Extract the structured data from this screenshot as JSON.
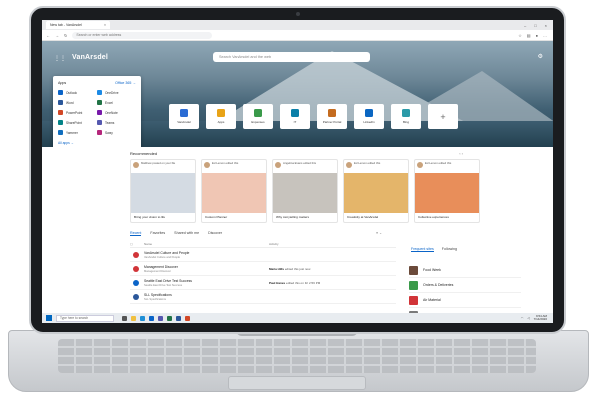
{
  "browser": {
    "tab_title": "New tab - VanArsdel",
    "address_placeholder": "Search or enter web address"
  },
  "header": {
    "brand": "VanArsdel",
    "search_placeholder": "Search VanArsdel and the web"
  },
  "quick_links": [
    {
      "label": "VanArsdel",
      "color": "#2b6cd4"
    },
    {
      "label": "Apps",
      "color": "#e8a317"
    },
    {
      "label": "Expenses",
      "color": "#3a9a4a"
    },
    {
      "label": "IT",
      "color": "#0a7fa8"
    },
    {
      "label": "Partner Portal",
      "color": "#c46b1f"
    },
    {
      "label": "LinkedIn",
      "color": "#0a66c2"
    },
    {
      "label": "Bing",
      "color": "#2b9aa8"
    }
  ],
  "launcher": {
    "title": "Apps",
    "more_link": "Office 365 →",
    "apps": [
      {
        "label": "Outlook",
        "color": "#0a64c8"
      },
      {
        "label": "OneDrive",
        "color": "#1c8ae5"
      },
      {
        "label": "Word",
        "color": "#2b579a"
      },
      {
        "label": "Excel",
        "color": "#217346"
      },
      {
        "label": "PowerPoint",
        "color": "#d24726"
      },
      {
        "label": "OneNote",
        "color": "#7719aa"
      },
      {
        "label": "SharePoint",
        "color": "#038387"
      },
      {
        "label": "Teams",
        "color": "#5558af"
      },
      {
        "label": "Yammer",
        "color": "#106ebe"
      },
      {
        "label": "Sway",
        "color": "#b5267b"
      }
    ],
    "all_apps": "All apps →"
  },
  "recommended": {
    "title": "Recommended",
    "cards": [
      {
        "header": "Matthew posted on your file",
        "caption": "Bring your vision to life",
        "color": "#d4dbe3"
      },
      {
        "header": "Ed Lemon edited this",
        "caption": "Custom Planner",
        "color": "#f0c6b4"
      },
      {
        "header": "Angelina Evans edited this",
        "caption": "Why storytelling matters",
        "color": "#c7c3bd"
      },
      {
        "header": "Ed Lemon edited this",
        "caption": "Creativity at VanArsdel",
        "color": "#e4b56a"
      },
      {
        "header": "Ed Lemon edited this",
        "caption": "Collective experiences",
        "color": "#e88e5a"
      }
    ]
  },
  "files": {
    "tabs": [
      "Recent",
      "Favorites",
      "Shared with me",
      "Discover"
    ],
    "columns": {
      "name": "Name",
      "activity": "Activity"
    },
    "rows": [
      {
        "name": "VanArsdel Culture and People",
        "sub": "VanArsdel Culture and People",
        "activity_user": "",
        "activity_text": "",
        "color": "#d13438"
      },
      {
        "name": "Management Discover",
        "sub": "Management Discover",
        "activity_user": "Maria Hills",
        "activity_text": "edited this just now",
        "color": "#d13438"
      },
      {
        "name": "Seattle East Drive Test Success",
        "sub": "Seattle East Drive Test Success",
        "activity_user": "Paul Hanes",
        "activity_text": "edited this on Fri 2:56 PM",
        "color": "#0a64c8"
      },
      {
        "name": "SLL Specifications",
        "sub": "SLL Specifications",
        "activity_user": "",
        "activity_text": "",
        "color": "#2b579a"
      }
    ]
  },
  "sites": {
    "tabs": [
      "Frequent sites",
      "Following"
    ],
    "items": [
      {
        "label": "Food Week",
        "color": "#6b4a3a"
      },
      {
        "label": "Orders & Deliveries",
        "color": "#3a9a4a"
      },
      {
        "label": "Air Material",
        "color": "#d13438"
      },
      {
        "label": "Public Relations",
        "color": "#7a7a7a"
      }
    ]
  },
  "taskbar": {
    "search_placeholder": "Type here to search",
    "time": "9:54 AM",
    "date": "7/14/2020"
  }
}
